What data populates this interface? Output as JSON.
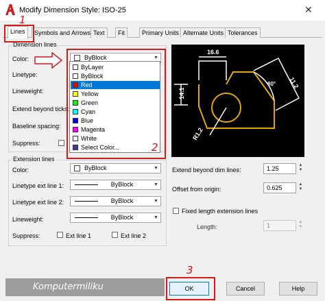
{
  "window": {
    "title": "Modify Dimension Style: ISO-25",
    "close_glyph": "✕"
  },
  "annotations": {
    "n1": "1",
    "n2": "2",
    "n3": "3"
  },
  "tabs": [
    {
      "label": "Lines",
      "active": true
    },
    {
      "label": "Symbols and Arrows"
    },
    {
      "label": "Text"
    },
    {
      "label": "Fit"
    },
    {
      "label": "Primary Units"
    },
    {
      "label": "Alternate Units"
    },
    {
      "label": "Tolerances"
    }
  ],
  "dimension_lines": {
    "group_label": "Dimension lines",
    "color_label": "Color:",
    "color_value": "ByBlock",
    "linetype_label": "Linetype:",
    "lineweight_label": "Lineweight:",
    "extend_label": "Extend beyond ticks:",
    "baseline_label": "Baseline spacing:",
    "suppress_label": "Suppress:"
  },
  "color_dropdown": {
    "items": [
      {
        "label": "ByLayer",
        "color": "#ffffff"
      },
      {
        "label": "ByBlock",
        "color": "#ffffff"
      },
      {
        "label": "Red",
        "color": "#ff0000",
        "selected": true
      },
      {
        "label": "Yellow",
        "color": "#ffff00"
      },
      {
        "label": "Green",
        "color": "#00ff00"
      },
      {
        "label": "Cyan",
        "color": "#00ffff"
      },
      {
        "label": "Blue",
        "color": "#0000ff"
      },
      {
        "label": "Magenta",
        "color": "#ff00ff"
      },
      {
        "label": "White",
        "color": "#ffffff"
      },
      {
        "label": "Select Color...",
        "color": "#3a3a9a"
      }
    ]
  },
  "extension_lines": {
    "group_label": "Extension lines",
    "color_label": "Color:",
    "color_value": "ByBlock",
    "linetype1_label": "Linetype ext line 1:",
    "linetype1_value": "ByBlock",
    "linetype2_label": "Linetype ext line 2:",
    "linetype2_value": "ByBlock",
    "lineweight_label": "Lineweight:",
    "lineweight_value": "ByBlock",
    "suppress_label": "Suppress:",
    "ext1_label": "Ext line 1",
    "ext2_label": "Ext line 2",
    "extend_label": "Extend beyond dim lines:",
    "extend_value": "1.25",
    "offset_label": "Offset from origin:",
    "offset_value": "0.625",
    "fixed_label": "Fixed length extension lines",
    "length_label": "Length:",
    "length_value": "1"
  },
  "preview": {
    "dim_top": "16.6",
    "dim_left": "14.1",
    "dim_right": "11.2",
    "dim_bottom": "R1.2",
    "dim_angle": "80°"
  },
  "watermark": "Komputermiliku",
  "buttons": {
    "ok": "OK",
    "cancel": "Cancel",
    "help": "Help"
  },
  "colors": {
    "accent_red": "#d51a1a",
    "preview_yellow": "#e8a800",
    "selection_blue": "#0078d7"
  },
  "icons": {
    "app": "autocad-a-icon",
    "dropdown": "chevron-down-icon",
    "spin": "spin-up-down-icon"
  }
}
